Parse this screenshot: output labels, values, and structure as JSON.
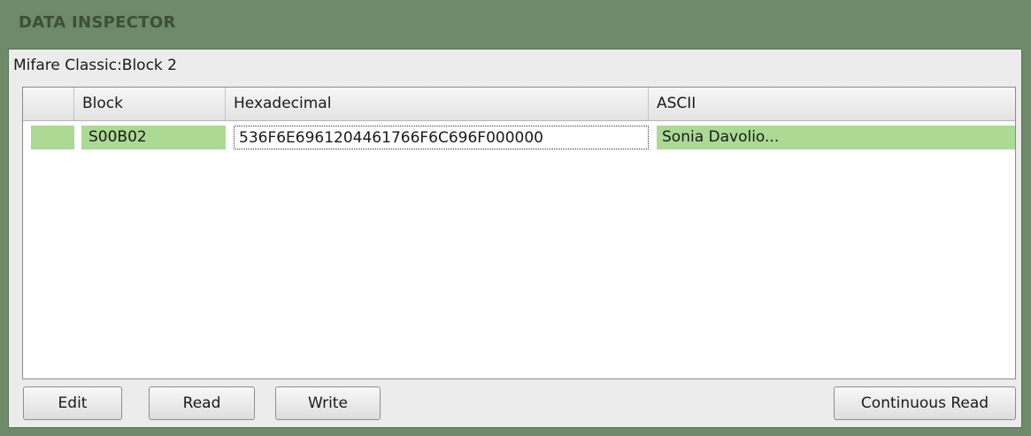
{
  "panel": {
    "title": "DATA INSPECTOR",
    "subtitle": "Mifare Classic:Block 2"
  },
  "table": {
    "columns": [
      "",
      "Block",
      "Hexadecimal",
      "ASCII"
    ],
    "rows": [
      {
        "status": "",
        "block": "S00B02",
        "hex": "536F6E6961204461766F6C696F000000",
        "ascii": "Sonia Davolio..."
      }
    ]
  },
  "buttons": {
    "edit": "Edit",
    "read": "Read",
    "write": "Write",
    "continuous_read": "Continuous Read"
  },
  "colors": {
    "panel_bg": "#6e8a68",
    "row_highlight": "#acd994"
  }
}
